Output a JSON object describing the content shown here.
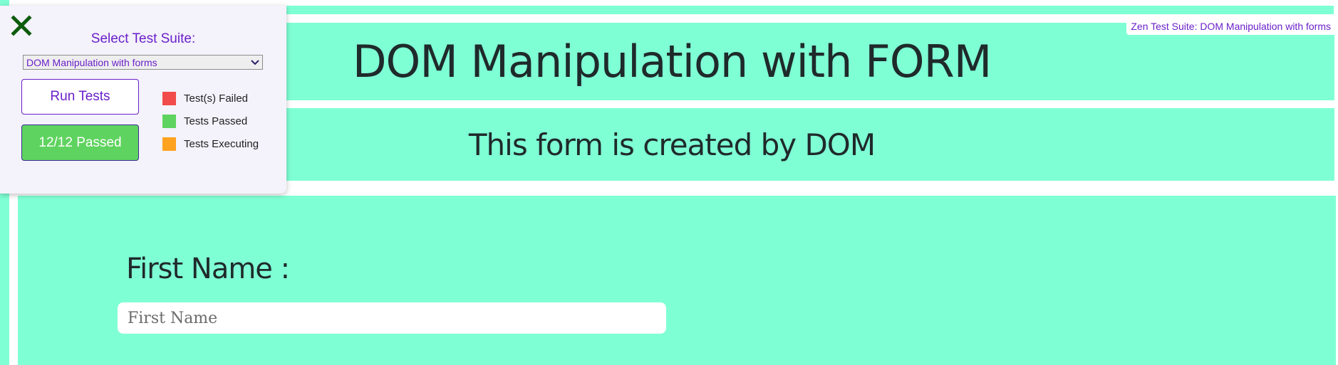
{
  "page": {
    "title": "DOM Manipulation with FORM",
    "subtitle": "This form is created by DOM",
    "form": {
      "first_name_label": "First Name :",
      "first_name_placeholder": "First Name",
      "first_name_value": ""
    }
  },
  "suite_tag": "Zen Test Suite: DOM Manipulation with forms",
  "test_panel": {
    "close_icon": "close-icon",
    "heading": "Select Test Suite:",
    "selected_suite": "DOM Manipulation with forms",
    "run_button_label": "Run Tests",
    "result_button_label": "12/12 Passed",
    "legend": [
      {
        "label": "Test(s) Failed",
        "color": "#f24b4b"
      },
      {
        "label": "Tests Passed",
        "color": "#5fd35f"
      },
      {
        "label": "Tests Executing",
        "color": "#ffa21f"
      }
    ]
  },
  "colors": {
    "page_background": "#7fffd4",
    "accent": "#6a1fc9",
    "passed": "#5fd35f",
    "close_icon": "#0d5c0d"
  }
}
